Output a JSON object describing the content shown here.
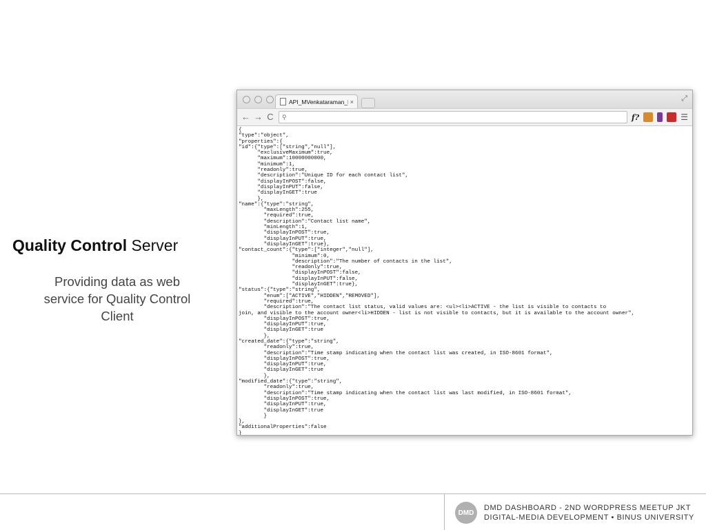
{
  "slide": {
    "title_bold": "Quality Control",
    "title_rest": " Server",
    "subtitle_lines": [
      "Providing data as web",
      "service for Quality Control",
      "Client"
    ]
  },
  "browser": {
    "tab_title": "API_MVenkataraman_RMan",
    "tab_close": "×",
    "toolbar": {
      "back": "←",
      "forward": "→",
      "reload": "C",
      "search_glyph": "⚲",
      "ext_f": "f?",
      "ext_new_color": "#d98a2b",
      "ext_phone_color": "#7a3a9a",
      "ext_new2_color": "#c92b2b",
      "menu": "☰"
    }
  },
  "json_lines": [
    "{",
    "\"type\":\"object\",",
    "\"properties\":{",
    "\"id\":{\"type\":[\"string\",\"null\"],",
    "      \"exclusiveMaximum\":true,",
    "      \"maximum\":10000000000,",
    "      \"minimum\":1,",
    "      \"readonly\":true,",
    "      \"description\":\"Unique ID for each contact list\",",
    "      \"displayInPOST\":false,",
    "      \"displayInPUT\":false,",
    "      \"displayInGET\":true",
    "      },",
    "\"name\":{\"type\":\"string\",",
    "        \"maxLength\":255,",
    "        \"required\":true,",
    "        \"description\":\"Contact list name\",",
    "        \"minLength\":1,",
    "        \"displayInPOST\":true,",
    "        \"displayInPUT\":true,",
    "        \"displayInGET\":true},",
    "\"contact_count\":{\"type\":[\"integer\",\"null\"],",
    "                 \"minimum\":0,",
    "                 \"description\":\"The number of contacts in the list\",",
    "                 \"readonly\":true,",
    "                 \"displayInPOST\":false,",
    "                 \"displayInPUT\":false,",
    "                 \"displayInGET\":true},",
    "\"status\":{\"type\":\"string\",",
    "        \"enum\":[\"ACTIVE\",\"HIDDEN\",\"REMOVED\"],",
    "        \"required\":true,",
    "        \"description\":\"The contact list status, valid values are: <ul><li>ACTIVE - the list is visible to contacts to",
    "join, and visible to the account owner<li>HIDDEN - list is not visible to contacts, but it is available to the account owner\",",
    "        \"displayInPOST\":true,",
    "        \"displayInPUT\":true,",
    "        \"displayInGET\":true",
    "        },",
    "\"created_date\":{\"type\":\"string\",",
    "        \"readonly\":true,",
    "        \"description\":\"Time stamp indicating when the contact list was created, in ISO-8601 format\",",
    "        \"displayInPOST\":true,",
    "        \"displayInPUT\":true,",
    "        \"displayInGET\":true",
    "        },",
    "\"modified_date\":{\"type\":\"string\",",
    "        \"readonly\":true,",
    "        \"description\":\"Time stamp indicating when the contact list was last modified, in ISO-8601 format\",",
    "        \"displayInPOST\":true,",
    "        \"displayInPUT\":true,",
    "        \"displayInGET\":true",
    "        }",
    "},",
    "\"additionalProperties\":false",
    "}"
  ],
  "footer": {
    "logo_text": "DMD",
    "line1": "DMD Dashboard - 2nd WordPress Meetup JKT",
    "line2": "Digital-Media Development • BINUS University"
  }
}
